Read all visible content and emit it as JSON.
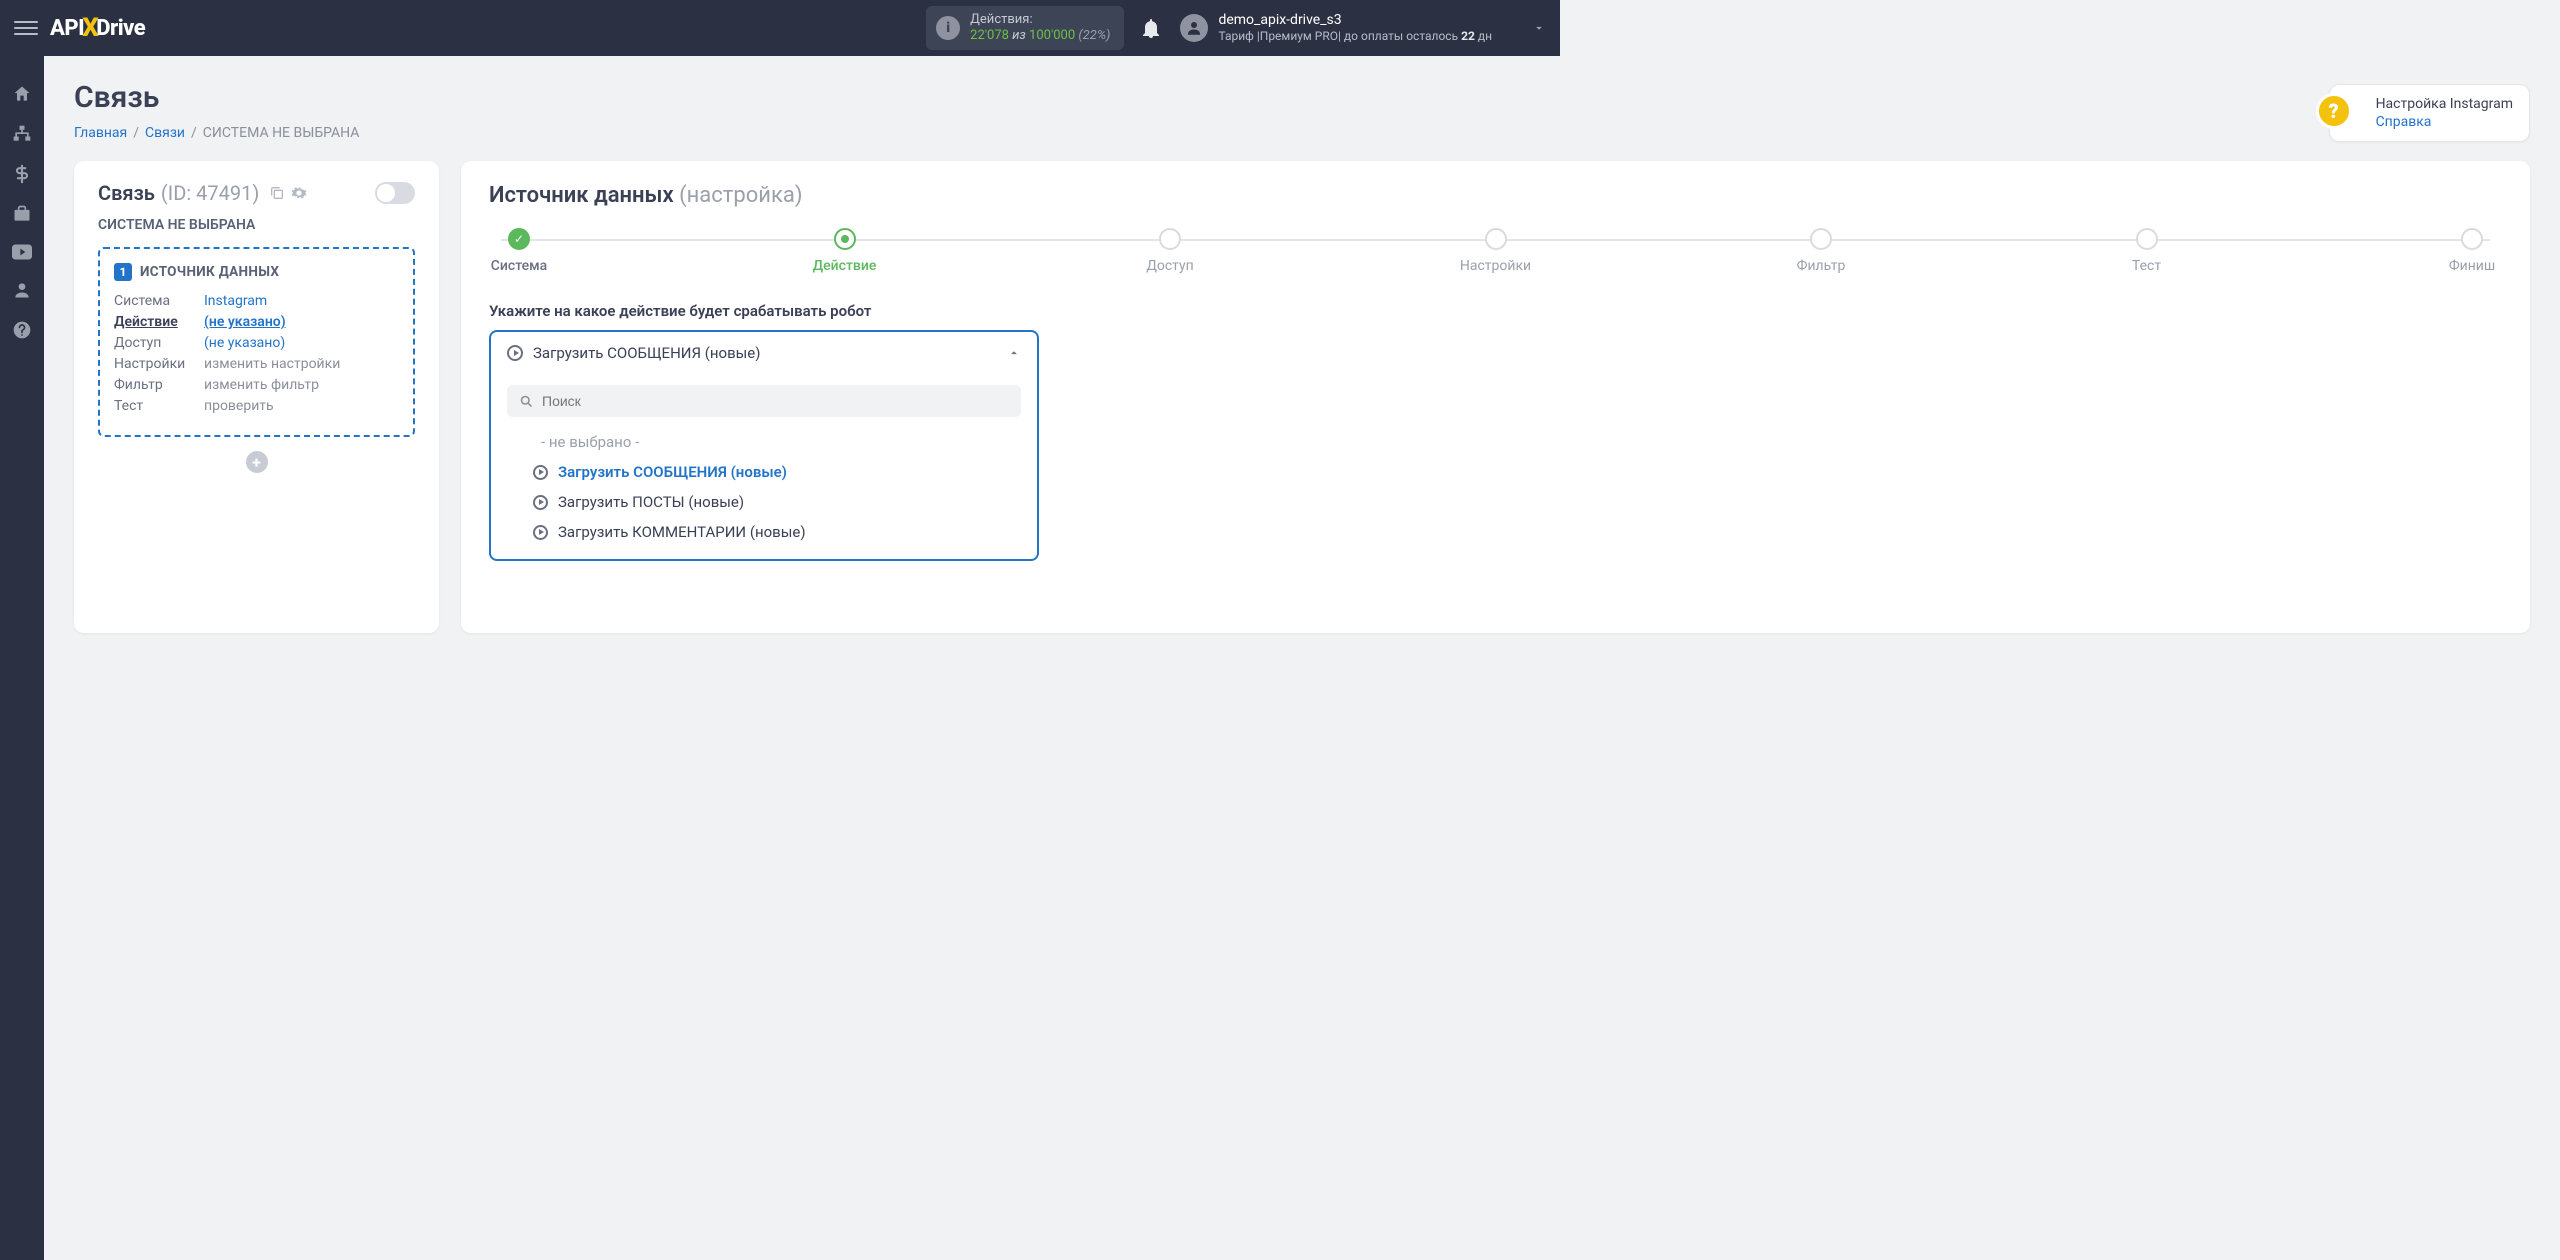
{
  "header": {
    "logo_part1": "API",
    "logo_part2": "Drive",
    "actions_label": "Действия:",
    "actions_used": "22'078",
    "actions_of": " из ",
    "actions_total": "100'000",
    "actions_pct": " (22%)",
    "user_name": "demo_apix-drive_s3",
    "user_tariff_prefix": "Тариф |Премиум PRO| до оплаты осталось ",
    "user_days": "22",
    "user_days_suffix": " дн"
  },
  "help": {
    "title": "Настройка Instagram",
    "link": "Справка"
  },
  "page": {
    "title": "Связь"
  },
  "breadcrumb": {
    "home": "Главная",
    "links": "Связи",
    "current": "СИСТЕМА НЕ ВЫБРАНА"
  },
  "left": {
    "title": "Связь",
    "id": "(ID: 47491)",
    "subtitle": "СИСТЕМА НЕ ВЫБРАНА",
    "src_head": "ИСТОЧНИК ДАННЫХ",
    "rows": {
      "system_lbl": "Система",
      "system_val": "Instagram",
      "action_lbl": "Действие",
      "action_val": "(не указано)",
      "access_lbl": "Доступ",
      "access_val": "(не указано)",
      "settings_lbl": "Настройки",
      "settings_val": "изменить настройки",
      "filter_lbl": "Фильтр",
      "filter_val": "изменить фильтр",
      "test_lbl": "Тест",
      "test_val": "проверить"
    }
  },
  "right": {
    "title_bold": "Источник данных",
    "title_grey": "(настройка)",
    "steps": [
      "Система",
      "Действие",
      "Доступ",
      "Настройки",
      "Фильтр",
      "Тест",
      "Финиш"
    ],
    "field_label": "Укажите на какое действие будет срабатывать робот",
    "selected": "Загрузить СООБЩЕНИЯ (новые)",
    "search_ph": "Поиск",
    "opt_placeholder": "- не выбрано -",
    "opts": [
      "Загрузить СООБЩЕНИЯ (новые)",
      "Загрузить ПОСТЫ (новые)",
      "Загрузить КОММЕНТАРИИ (новые)"
    ]
  }
}
